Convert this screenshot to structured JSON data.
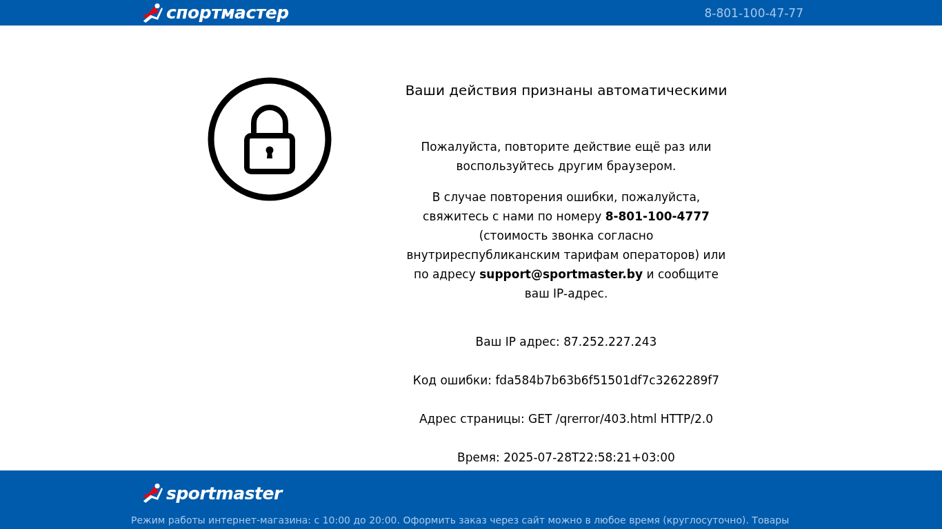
{
  "header": {
    "logo": "спортмастер",
    "phone": "8-801-100-47-77"
  },
  "message": {
    "title": "Ваши действия признаны автоматическими",
    "paragraphs": [
      "Пожалуйста, повторите действие ещё раз или воспользуйтесь другим браузером.",
      "В случае повторения ошибки, пожалуйста, свяжитесь с нами по номеру **8-801-100-4777** (стоимость звонка согласно внутриреспубликанским тарифам операторов) или по адресу **support@sportmaster.by** и сообщите ваш IP-адрес."
    ],
    "details": [
      "Ваш IP адрес: 87.252.227.243",
      "Код ошибки: fda584b7b63b6f51501df7c3262289f7",
      "Адрес страницы: GET /qrerror/403.html HTTP/2.0",
      "Время: 2025-07-28T22:58:21+03:00"
    ]
  },
  "footer": {
    "logo": "sportmaster",
    "text": "Режим работы интернет-магазина: с 10:00 до 20:00. Оформить заказ через сайт можно в любое время (круглосуточно). Товары"
  }
}
